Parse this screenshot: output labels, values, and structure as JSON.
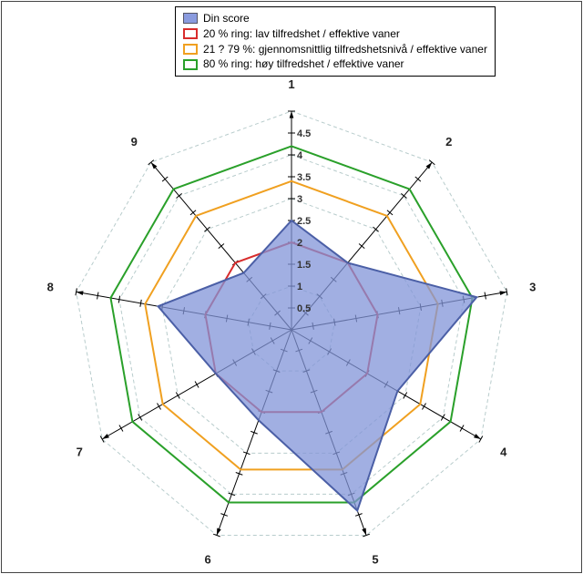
{
  "chart_data": {
    "type": "radar",
    "categories": [
      "1",
      "2",
      "3",
      "4",
      "5",
      "6",
      "7",
      "8",
      "9"
    ],
    "axis": {
      "min": 0,
      "max": 5,
      "step": 0.5
    },
    "axis_ticks": [
      "0.5",
      "1",
      "1.5",
      "2",
      "2.5",
      "3",
      "3.5",
      "4",
      "4.5"
    ],
    "series": [
      {
        "name": "Din score",
        "color_fill": "#8194d8",
        "color_stroke": "#4b5fa6",
        "type": "area",
        "values": [
          2.5,
          2.0,
          4.3,
          2.8,
          4.4,
          2.2,
          2.0,
          3.1,
          1.7
        ]
      },
      {
        "name": "20 % ring: lav tilfredshet / effektive vaner",
        "color_stroke": "#d82c2c",
        "type": "line",
        "values": [
          2.0,
          2.0,
          2.0,
          2.0,
          2.0,
          2.0,
          2.0,
          2.0,
          2.0
        ]
      },
      {
        "name": "21 ? 79 %: gjennomsnittlig tilfredshetsnivå / effektive vaner",
        "color_stroke": "#f0a020",
        "type": "line",
        "values": [
          3.4,
          3.4,
          3.4,
          3.4,
          3.4,
          3.4,
          3.4,
          3.4,
          3.4
        ]
      },
      {
        "name": "80 % ring: høy tilfredshet / effektive vaner",
        "color_stroke": "#2aa02a",
        "type": "line",
        "values": [
          4.2,
          4.2,
          4.2,
          4.2,
          4.2,
          4.2,
          4.2,
          4.2,
          4.2
        ]
      }
    ],
    "grid_rings": [
      1,
      2,
      3,
      4,
      5
    ],
    "legend_position": "top"
  },
  "legend": {
    "l0": "Din score",
    "l1": "20 % ring: lav tilfredshet / effektive vaner",
    "l2": "21 ? 79 %: gjennomsnittlig tilfredshetsnivå / effektive vaner",
    "l3": "80 % ring: høy tilfredshet / effektive vaner"
  }
}
